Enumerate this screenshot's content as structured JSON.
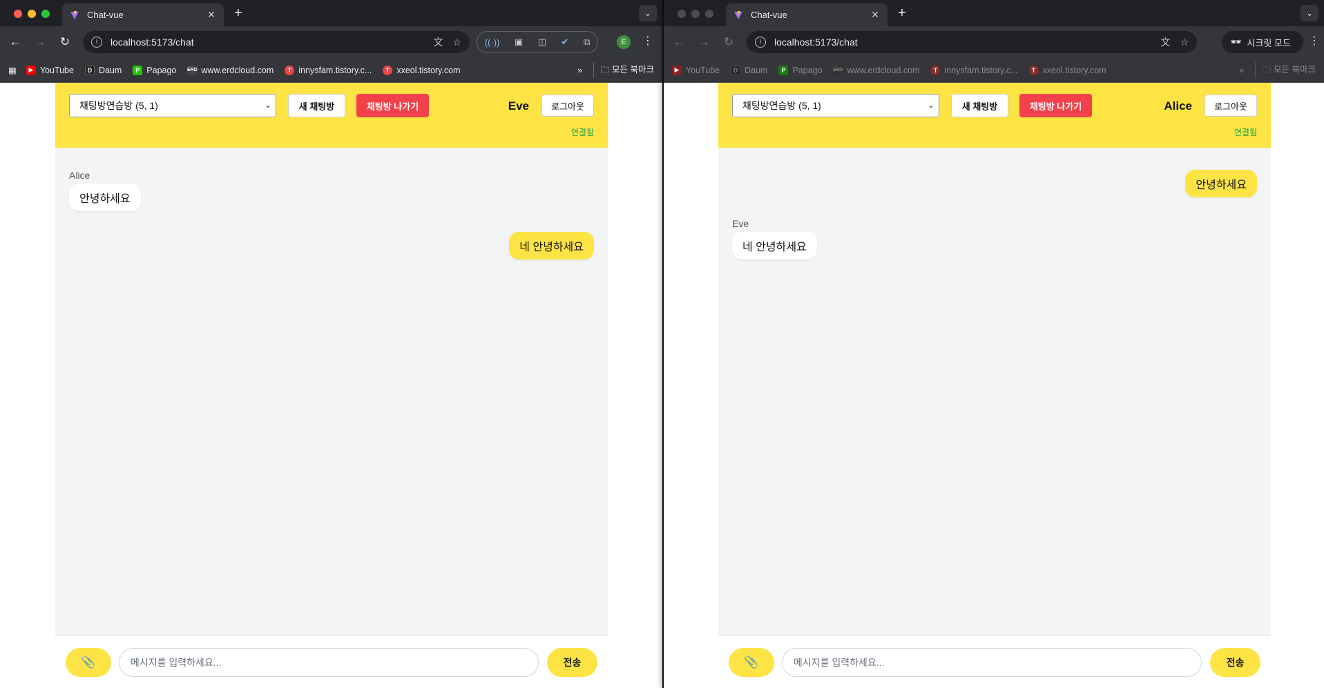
{
  "tab_title": "Chat-vue",
  "url": "localhost:5173/chat",
  "bookmarks": [
    "YouTube",
    "Daum",
    "Papago",
    "www.erdcloud.com",
    "innysfam.tistory.c...",
    "xxeol.tistory.com"
  ],
  "bookmarks_overflow": "»",
  "all_bookmarks": "모든 북마크",
  "profile_initial": "E",
  "incognito_label": "시크릿 모드",
  "app": {
    "room_select": "채팅방연습방 (5, 1)",
    "new_room": "새 채팅방",
    "leave_room": "채팅방 나가기",
    "logout": "로그아웃",
    "connection_status": "연결됨",
    "input_placeholder": "메시지를 입력하세요...",
    "send": "전송",
    "attach_icon": "📎"
  },
  "window1": {
    "user": "Eve",
    "messages": [
      {
        "sender": "Alice",
        "text": "안녕하세요",
        "mine": false
      },
      {
        "sender": "",
        "text": "네 안녕하세요",
        "mine": true
      }
    ]
  },
  "window2": {
    "user": "Alice",
    "messages": [
      {
        "sender": "",
        "text": "안녕하세요",
        "mine": true
      },
      {
        "sender": "Eve",
        "text": "네 안녕하세요",
        "mine": false
      }
    ]
  },
  "colors": {
    "accent": "#fde444",
    "danger": "#f2414a",
    "connected": "#16a34a",
    "chrome": "#35363a"
  }
}
